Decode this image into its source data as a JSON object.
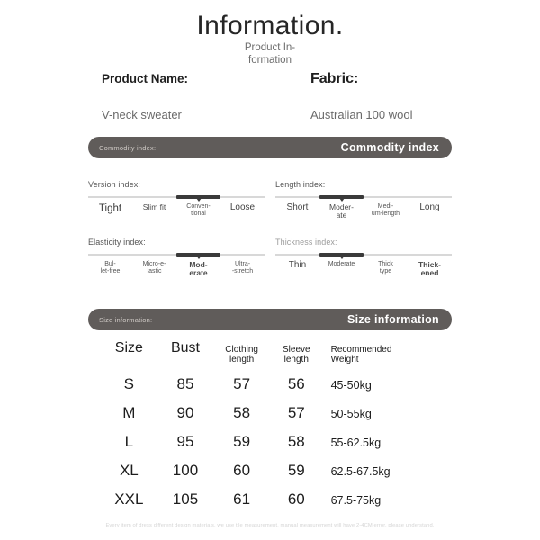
{
  "header": {
    "title": "Information.",
    "subtitle": "Product In-formation"
  },
  "product": {
    "name_label": "Product Name:",
    "name_value": "V-neck sweater",
    "fabric_label": "Fabric:",
    "fabric_value": "Australian 100 wool"
  },
  "commodity_bar": {
    "left_label": "Commodity index:",
    "right_label": "Commodity index"
  },
  "size_bar": {
    "left_label": "Size information:",
    "right_label": "Size information"
  },
  "indices": [
    {
      "key": "version",
      "title": "Version index:",
      "active": 2,
      "options": [
        {
          "lines": [
            "Tight"
          ],
          "size": "s-xl"
        },
        {
          "lines": [
            "Slim fit"
          ],
          "size": "s-md"
        },
        {
          "lines": [
            "Conven-",
            "tional"
          ],
          "size": "s-sm"
        },
        {
          "lines": [
            "Loose"
          ],
          "size": "s-lg"
        }
      ]
    },
    {
      "key": "length",
      "title": "Length index:",
      "active": 1,
      "options": [
        {
          "lines": [
            "Short"
          ],
          "size": "s-lg"
        },
        {
          "lines": [
            "Moder-",
            "ate"
          ],
          "size": "s-md"
        },
        {
          "lines": [
            "Medi-",
            "um-length"
          ],
          "size": "s-sm"
        },
        {
          "lines": [
            "Long"
          ],
          "size": "s-lg"
        }
      ]
    },
    {
      "key": "elasticity",
      "title": "Elasticity index:",
      "active": 2,
      "options": [
        {
          "lines": [
            "Bul-",
            "let-free"
          ],
          "size": "s-sm"
        },
        {
          "lines": [
            "Micro-e-",
            "lastic"
          ],
          "size": "s-sm"
        },
        {
          "lines": [
            "Mod-",
            "erate"
          ],
          "size": "s-md s-bold"
        },
        {
          "lines": [
            "Ultra-",
            "-stretch"
          ],
          "size": "s-sm"
        }
      ]
    },
    {
      "key": "thickness",
      "title": "Thickness index:",
      "active": 1,
      "faint_title": true,
      "options": [
        {
          "lines": [
            "Thin"
          ],
          "size": "s-lg"
        },
        {
          "lines": [
            "Moderate"
          ],
          "size": "s-sm"
        },
        {
          "lines": [
            "Thick",
            "type"
          ],
          "size": "s-sm"
        },
        {
          "lines": [
            "Thick-",
            "ened"
          ],
          "size": "s-md s-bold"
        }
      ]
    }
  ],
  "size_table": {
    "columns": [
      "Size",
      "Bust",
      "Clothing length",
      "Sleeve length",
      "Recommended Weight"
    ],
    "columns_wrapped": [
      [
        "Size"
      ],
      [
        "Bust"
      ],
      [
        "Clothing",
        "length"
      ],
      [
        "Sleeve",
        "length"
      ],
      [
        "Recommended",
        "Weight"
      ]
    ],
    "rows": [
      {
        "size": "S",
        "bust": "85",
        "clothing_length": "57",
        "sleeve_length": "56",
        "weight": "45-50kg"
      },
      {
        "size": "M",
        "bust": "90",
        "clothing_length": "58",
        "sleeve_length": "57",
        "weight": "50-55kg"
      },
      {
        "size": "L",
        "bust": "95",
        "clothing_length": "59",
        "sleeve_length": "58",
        "weight": "55-62.5kg"
      },
      {
        "size": "XL",
        "bust": "100",
        "clothing_length": "60",
        "sleeve_length": "59",
        "weight": "62.5-67.5kg"
      },
      {
        "size": "XXL",
        "bust": "105",
        "clothing_length": "61",
        "sleeve_length": "60",
        "weight": "67.5-75kg"
      }
    ]
  },
  "footer": {
    "disclaimer": "Every item of dress different design materials, we use tile measurement, manual measurement will have 2-4CM error, please understand."
  },
  "colors": {
    "bar_background": "#605c5a",
    "page_background": "#ffffff",
    "active_segment": "#3a3a3a",
    "inactive_segment": "#d8d8d8"
  }
}
